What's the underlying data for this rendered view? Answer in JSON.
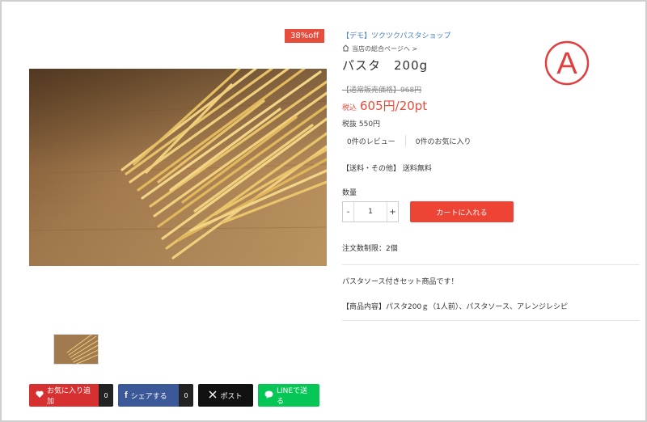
{
  "discount_badge": "38%off",
  "shop_name": "【デモ】ツクツクパスタショップ",
  "home_link": "当店の総合ページへ >",
  "product_title": "パスタ　200g",
  "regular_price": "【通常販売価格】968円",
  "price_prefix": "税込",
  "price": "605円/20pt",
  "price_without_tax": "税抜 550円",
  "reviews": "0件のレビュー",
  "favorites": "0件のお気に入り",
  "shipping": "【送料・その他】 送料無料",
  "quantity_label": "数量",
  "quantity": {
    "minus": "-",
    "value": "1",
    "plus": "+"
  },
  "cart_button": "カートに入れる",
  "order_limit": "注文数制限：2個",
  "description": "パスタソース付きセット商品です！",
  "contents": "【商品内容】パスタ200ｇ（1人前）、パスタソース、アレンジレシピ",
  "share": {
    "favorite": {
      "label": "お気に入り追加",
      "count": "0"
    },
    "facebook": {
      "label": "シェアする",
      "count": "0"
    },
    "x": {
      "label": "ポスト"
    },
    "line": {
      "label": "LINEで送る"
    }
  },
  "logo_letter": "A",
  "colors": {
    "accent": "#ee4436",
    "badge": "#e74c3c",
    "shop_link": "#4a7fc0",
    "logo": "#e23d3d"
  },
  "icons": [
    "home-icon",
    "heart-icon",
    "facebook-icon",
    "x-icon",
    "line-icon"
  ]
}
